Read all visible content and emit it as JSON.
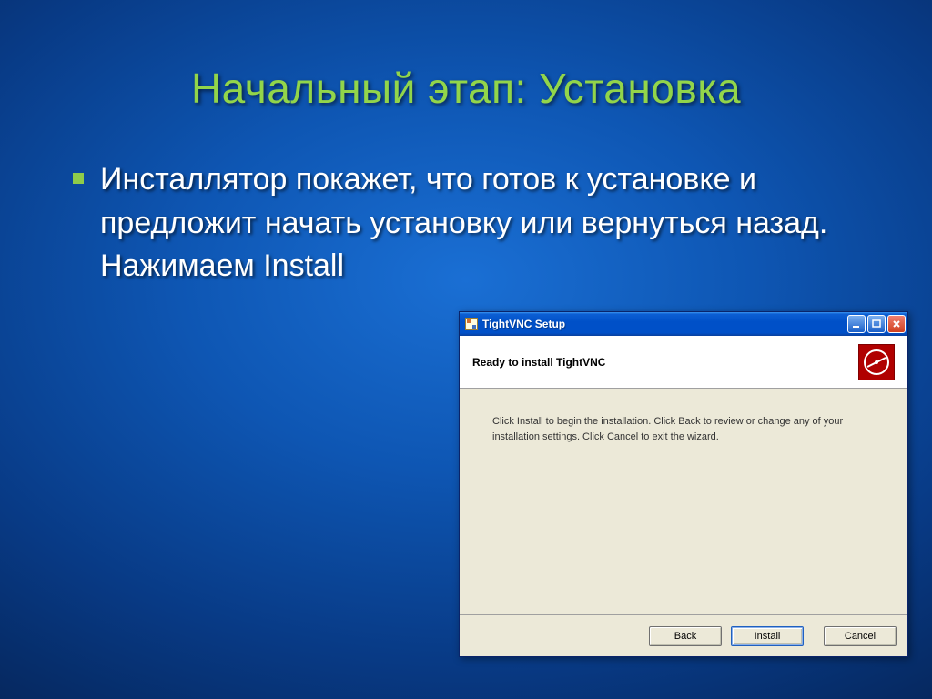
{
  "slide": {
    "title": "Начальный этап: Установка",
    "bullet_text": "Инсталлятор покажет, что готов к установке и предложит начать установку или вернуться назад. Нажимаем Install"
  },
  "installer": {
    "window_title": "TightVNC Setup",
    "heading": "Ready to install TightVNC",
    "body_text": "Click Install to begin the installation. Click Back to review or change any of your installation settings. Click Cancel to exit the wizard.",
    "buttons": {
      "back": "Back",
      "install": "Install",
      "cancel": "Cancel"
    }
  }
}
